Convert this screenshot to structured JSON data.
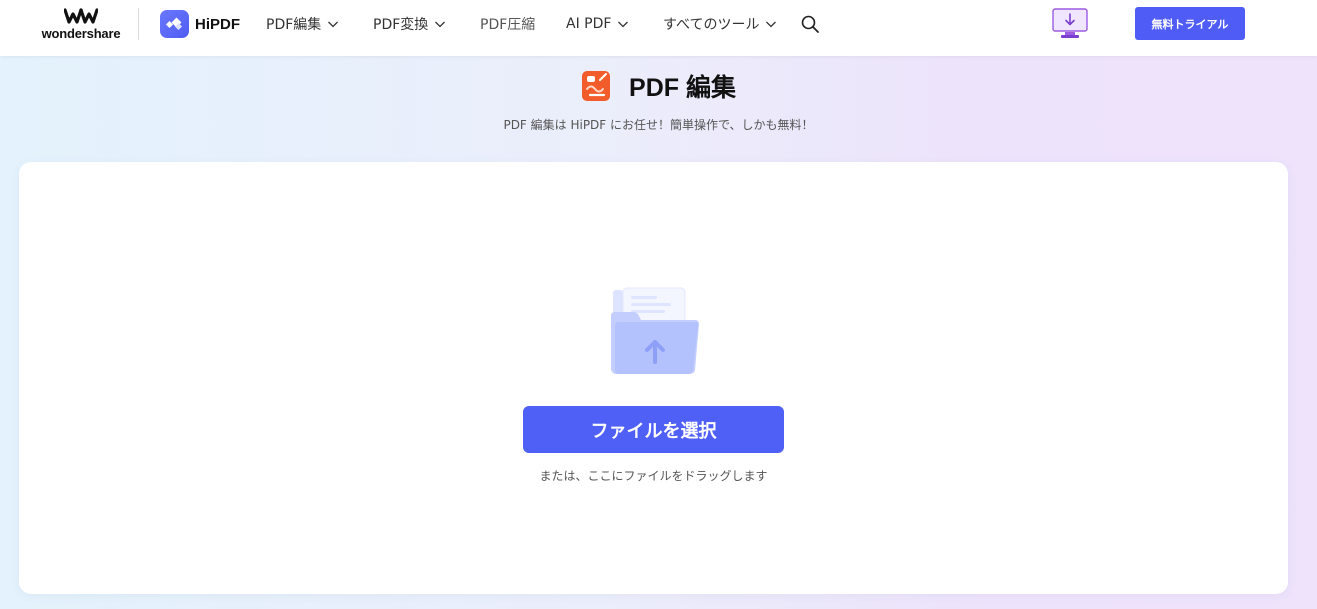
{
  "header": {
    "brand": "wondershare",
    "product": "HiPDF",
    "nav": [
      {
        "label": "PDF編集",
        "has_dropdown": true
      },
      {
        "label": "PDF変換",
        "has_dropdown": true
      },
      {
        "label": "PDF圧縮",
        "has_dropdown": false
      },
      {
        "label": "AI PDF",
        "has_dropdown": true
      },
      {
        "label": "すべてのツール",
        "has_dropdown": true
      }
    ],
    "trial_button": "無料トライアル",
    "icons": {
      "search": "search-icon",
      "download": "desktop-download-icon"
    }
  },
  "page": {
    "title": "PDF 編集",
    "subtitle": "PDF 編集は HiPDF にお任せ！簡単操作で、しかも無料！"
  },
  "upload": {
    "button": "ファイルを選択",
    "hint": "または、ここにファイルをドラッグします"
  },
  "colors": {
    "accent": "#4f60f7",
    "title_icon": "#f25c2a"
  }
}
